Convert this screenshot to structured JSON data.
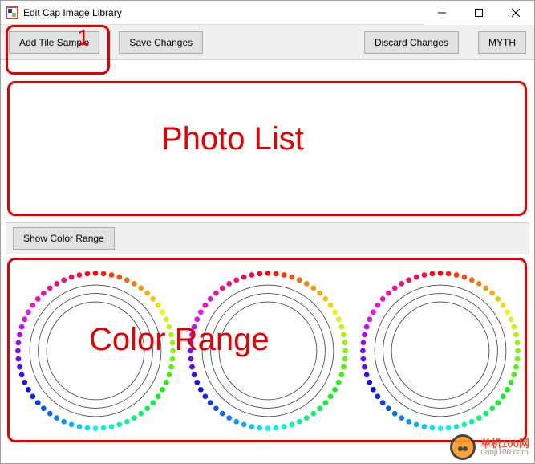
{
  "window": {
    "title": "Edit Cap Image Library"
  },
  "toolbar": {
    "add_tile_sample": "Add Tile Sample",
    "save_changes": "Save Changes",
    "discard_changes": "Discard Changes",
    "myth": "MYTH"
  },
  "colorrange": {
    "show_button": "Show Color Range"
  },
  "annotations": {
    "num_1": "1",
    "photo_list": "Photo List",
    "color_range": "Color Range"
  },
  "watermark": {
    "line1": "单机100网",
    "line2": "danji100.com"
  }
}
